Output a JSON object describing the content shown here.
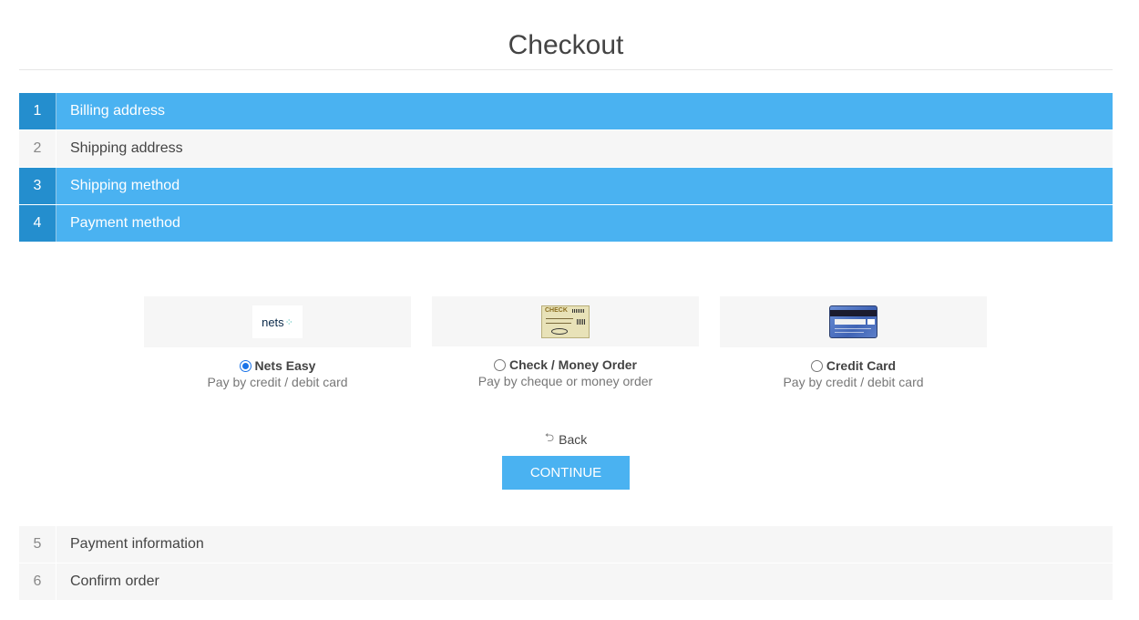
{
  "page": {
    "title": "Checkout"
  },
  "steps": [
    {
      "number": "1",
      "label": "Billing address",
      "state": "active"
    },
    {
      "number": "2",
      "label": "Shipping address",
      "state": "inactive"
    },
    {
      "number": "3",
      "label": "Shipping method",
      "state": "active"
    },
    {
      "number": "4",
      "label": "Payment method",
      "state": "active"
    },
    {
      "number": "5",
      "label": "Payment information",
      "state": "inactive"
    },
    {
      "number": "6",
      "label": "Confirm order",
      "state": "inactive"
    }
  ],
  "payment_methods": [
    {
      "name": "Nets Easy",
      "description": "Pay by credit / debit card",
      "selected": true,
      "logo": "nets",
      "logo_text": "nets"
    },
    {
      "name": "Check / Money Order",
      "description": "Pay by cheque or money order",
      "selected": false,
      "logo": "check",
      "logo_text": "CHECK"
    },
    {
      "name": "Credit Card",
      "description": "Pay by credit / debit card",
      "selected": false,
      "logo": "credit-card-back"
    }
  ],
  "actions": {
    "back_label": "Back",
    "continue_label": "CONTINUE"
  },
  "colors": {
    "accent": "#4ab2f1",
    "accent_dark": "#248ece",
    "inactive_bg": "#f6f6f6",
    "text": "#444444"
  }
}
